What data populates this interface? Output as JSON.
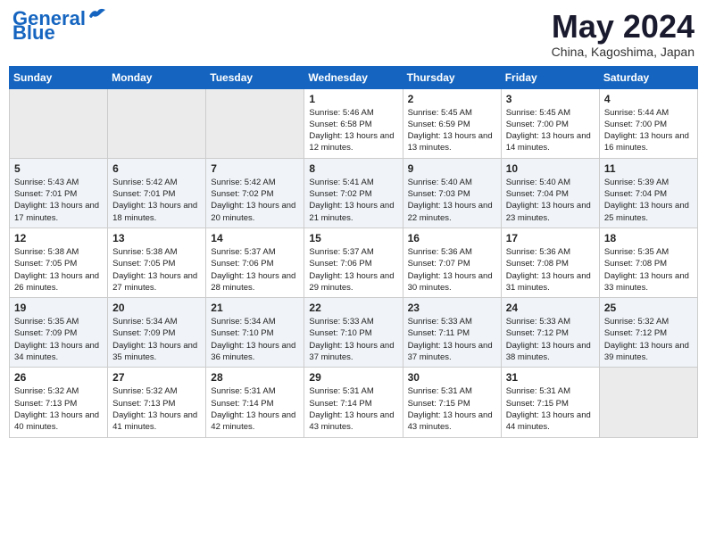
{
  "header": {
    "logo_line1": "General",
    "logo_line2": "Blue",
    "month": "May 2024",
    "location": "China, Kagoshima, Japan"
  },
  "weekdays": [
    "Sunday",
    "Monday",
    "Tuesday",
    "Wednesday",
    "Thursday",
    "Friday",
    "Saturday"
  ],
  "weeks": [
    [
      {
        "day": "",
        "empty": true
      },
      {
        "day": "",
        "empty": true
      },
      {
        "day": "",
        "empty": true
      },
      {
        "day": "1",
        "sunrise": "5:46 AM",
        "sunset": "6:58 PM",
        "daylight": "13 hours and 12 minutes."
      },
      {
        "day": "2",
        "sunrise": "5:45 AM",
        "sunset": "6:59 PM",
        "daylight": "13 hours and 13 minutes."
      },
      {
        "day": "3",
        "sunrise": "5:45 AM",
        "sunset": "7:00 PM",
        "daylight": "13 hours and 14 minutes."
      },
      {
        "day": "4",
        "sunrise": "5:44 AM",
        "sunset": "7:00 PM",
        "daylight": "13 hours and 16 minutes."
      }
    ],
    [
      {
        "day": "5",
        "sunrise": "5:43 AM",
        "sunset": "7:01 PM",
        "daylight": "13 hours and 17 minutes."
      },
      {
        "day": "6",
        "sunrise": "5:42 AM",
        "sunset": "7:01 PM",
        "daylight": "13 hours and 18 minutes."
      },
      {
        "day": "7",
        "sunrise": "5:42 AM",
        "sunset": "7:02 PM",
        "daylight": "13 hours and 20 minutes."
      },
      {
        "day": "8",
        "sunrise": "5:41 AM",
        "sunset": "7:02 PM",
        "daylight": "13 hours and 21 minutes."
      },
      {
        "day": "9",
        "sunrise": "5:40 AM",
        "sunset": "7:03 PM",
        "daylight": "13 hours and 22 minutes."
      },
      {
        "day": "10",
        "sunrise": "5:40 AM",
        "sunset": "7:04 PM",
        "daylight": "13 hours and 23 minutes."
      },
      {
        "day": "11",
        "sunrise": "5:39 AM",
        "sunset": "7:04 PM",
        "daylight": "13 hours and 25 minutes."
      }
    ],
    [
      {
        "day": "12",
        "sunrise": "5:38 AM",
        "sunset": "7:05 PM",
        "daylight": "13 hours and 26 minutes."
      },
      {
        "day": "13",
        "sunrise": "5:38 AM",
        "sunset": "7:05 PM",
        "daylight": "13 hours and 27 minutes."
      },
      {
        "day": "14",
        "sunrise": "5:37 AM",
        "sunset": "7:06 PM",
        "daylight": "13 hours and 28 minutes."
      },
      {
        "day": "15",
        "sunrise": "5:37 AM",
        "sunset": "7:06 PM",
        "daylight": "13 hours and 29 minutes."
      },
      {
        "day": "16",
        "sunrise": "5:36 AM",
        "sunset": "7:07 PM",
        "daylight": "13 hours and 30 minutes."
      },
      {
        "day": "17",
        "sunrise": "5:36 AM",
        "sunset": "7:08 PM",
        "daylight": "13 hours and 31 minutes."
      },
      {
        "day": "18",
        "sunrise": "5:35 AM",
        "sunset": "7:08 PM",
        "daylight": "13 hours and 33 minutes."
      }
    ],
    [
      {
        "day": "19",
        "sunrise": "5:35 AM",
        "sunset": "7:09 PM",
        "daylight": "13 hours and 34 minutes."
      },
      {
        "day": "20",
        "sunrise": "5:34 AM",
        "sunset": "7:09 PM",
        "daylight": "13 hours and 35 minutes."
      },
      {
        "day": "21",
        "sunrise": "5:34 AM",
        "sunset": "7:10 PM",
        "daylight": "13 hours and 36 minutes."
      },
      {
        "day": "22",
        "sunrise": "5:33 AM",
        "sunset": "7:10 PM",
        "daylight": "13 hours and 37 minutes."
      },
      {
        "day": "23",
        "sunrise": "5:33 AM",
        "sunset": "7:11 PM",
        "daylight": "13 hours and 37 minutes."
      },
      {
        "day": "24",
        "sunrise": "5:33 AM",
        "sunset": "7:12 PM",
        "daylight": "13 hours and 38 minutes."
      },
      {
        "day": "25",
        "sunrise": "5:32 AM",
        "sunset": "7:12 PM",
        "daylight": "13 hours and 39 minutes."
      }
    ],
    [
      {
        "day": "26",
        "sunrise": "5:32 AM",
        "sunset": "7:13 PM",
        "daylight": "13 hours and 40 minutes."
      },
      {
        "day": "27",
        "sunrise": "5:32 AM",
        "sunset": "7:13 PM",
        "daylight": "13 hours and 41 minutes."
      },
      {
        "day": "28",
        "sunrise": "5:31 AM",
        "sunset": "7:14 PM",
        "daylight": "13 hours and 42 minutes."
      },
      {
        "day": "29",
        "sunrise": "5:31 AM",
        "sunset": "7:14 PM",
        "daylight": "13 hours and 43 minutes."
      },
      {
        "day": "30",
        "sunrise": "5:31 AM",
        "sunset": "7:15 PM",
        "daylight": "13 hours and 43 minutes."
      },
      {
        "day": "31",
        "sunrise": "5:31 AM",
        "sunset": "7:15 PM",
        "daylight": "13 hours and 44 minutes."
      },
      {
        "day": "",
        "empty": true
      }
    ]
  ],
  "labels": {
    "sunrise_prefix": "Sunrise: ",
    "sunset_prefix": "Sunset: ",
    "daylight_prefix": "Daylight: "
  }
}
